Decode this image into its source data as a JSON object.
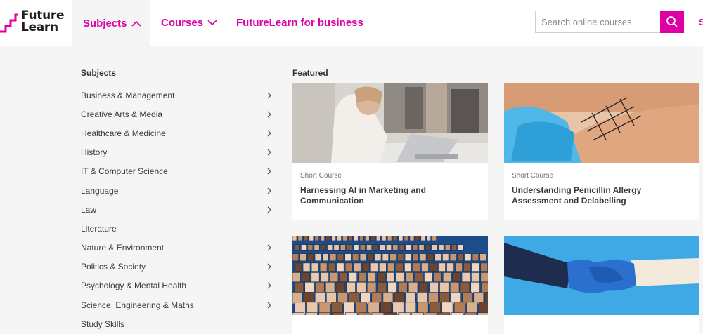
{
  "header": {
    "logo_line1": "Future",
    "logo_line2": "Learn",
    "nav": {
      "subjects": "Subjects",
      "courses": "Courses",
      "business": "FutureLearn for business"
    },
    "search_placeholder": "Search online courses",
    "edge_link": "S"
  },
  "menu": {
    "heading": "Subjects",
    "items": [
      {
        "label": "Business & Management",
        "has_arrow": true
      },
      {
        "label": "Creative Arts & Media",
        "has_arrow": true
      },
      {
        "label": "Healthcare & Medicine",
        "has_arrow": true
      },
      {
        "label": "History",
        "has_arrow": true
      },
      {
        "label": "IT & Computer Science",
        "has_arrow": true
      },
      {
        "label": "Language",
        "has_arrow": true
      },
      {
        "label": "Law",
        "has_arrow": true
      },
      {
        "label": "Literature",
        "has_arrow": false
      },
      {
        "label": "Nature & Environment",
        "has_arrow": true
      },
      {
        "label": "Politics & Society",
        "has_arrow": true
      },
      {
        "label": "Psychology & Mental Health",
        "has_arrow": true
      },
      {
        "label": "Science, Engineering & Maths",
        "has_arrow": true
      },
      {
        "label": "Study Skills",
        "has_arrow": false
      }
    ]
  },
  "featured": {
    "heading": "Featured",
    "cards": [
      {
        "type": "Short Course",
        "title": "Harnessing AI in Marketing and Communication"
      },
      {
        "type": "Short Course",
        "title": "Understanding Penicillin Allergy Assessment and Delabelling"
      },
      {
        "type": "",
        "title": ""
      },
      {
        "type": "",
        "title": ""
      }
    ]
  },
  "colors": {
    "brand": "#de00a5",
    "menu_bg": "#f5f5f5",
    "card_bg": "#ffffff"
  }
}
